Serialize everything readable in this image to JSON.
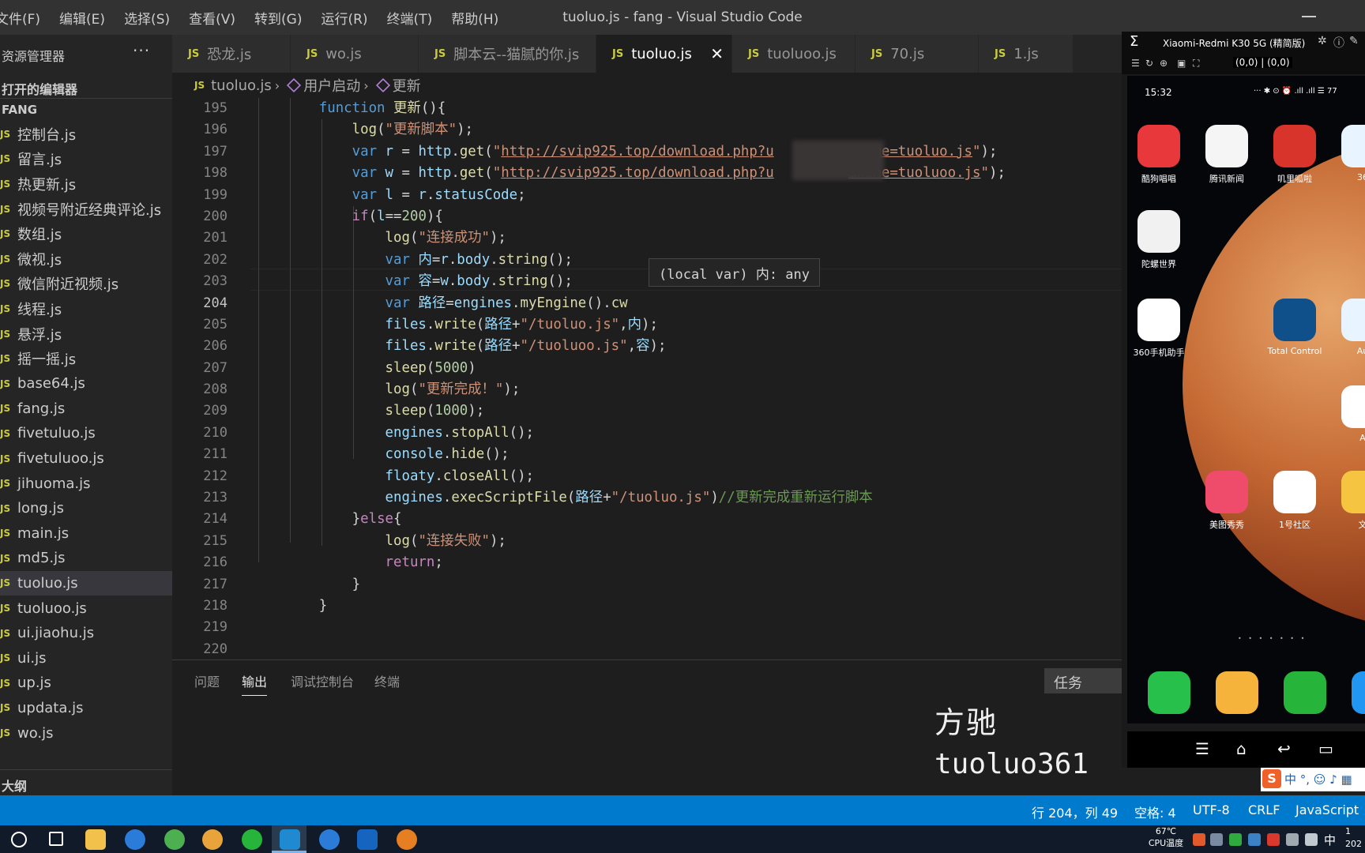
{
  "window": {
    "title": "tuoluo.js - fang - Visual Studio Code"
  },
  "menu": [
    "文件(F)",
    "编辑(E)",
    "选择(S)",
    "查看(V)",
    "转到(G)",
    "运行(R)",
    "终端(T)",
    "帮助(H)"
  ],
  "sidebar": {
    "title": "资源管理器",
    "more": "···",
    "open_editors": "打开的编辑器",
    "folder": "FANG",
    "files": [
      "控制台.js",
      "留言.js",
      "热更新.js",
      "视频号附近经典评论.js",
      "数组.js",
      "微视.js",
      "微信附近视频.js",
      "线程.js",
      "悬浮.js",
      "摇一摇.js",
      "base64.js",
      "fang.js",
      "fivetuluo.js",
      "fivetuluoo.js",
      "jihuoma.js",
      "long.js",
      "main.js",
      "md5.js",
      "tuoluo.js",
      "tuoluoo.js",
      "ui.jiaohu.js",
      "ui.js",
      "up.js",
      "updata.js",
      "wo.js"
    ],
    "active_file": "tuoluo.js",
    "outline": "大纲"
  },
  "tabs": [
    {
      "label": "恐龙.js",
      "active": false
    },
    {
      "label": "wo.js",
      "active": false
    },
    {
      "label": "脚本云--猫腻的你.js",
      "active": false
    },
    {
      "label": "tuoluo.js",
      "active": true
    },
    {
      "label": "tuoluoo.js",
      "active": false
    },
    {
      "label": "70.js",
      "active": false
    },
    {
      "label": "1.js",
      "active": false
    }
  ],
  "tab_badge": "JS",
  "breadcrumb": {
    "file": "tuoluo.js",
    "item1": "用户启动",
    "item2": "更新"
  },
  "editor": {
    "line_numbers": [
      "195",
      "196",
      "197",
      "198",
      "199",
      "200",
      "201",
      "202",
      "203",
      "204",
      "205",
      "206",
      "207",
      "208",
      "209",
      "210",
      "211",
      "212",
      "213",
      "214",
      "215",
      "216",
      "217",
      "218",
      "219",
      "220"
    ],
    "current_line": "204",
    "hover": "(local var) 内: any",
    "url1_prefix": "http://svip925.top/download.php?u",
    "url1_suffix": "&name=tuoluo.js",
    "url2_suffix": "&name=tuoluoo.js"
  },
  "panel": {
    "tabs": [
      "问题",
      "输出",
      "调试控制台",
      "终端"
    ],
    "active_tab": "输出",
    "task_select": "任务"
  },
  "watermark": {
    "name": "方驰",
    "handle": "tuoluo361"
  },
  "statusbar": {
    "position": "行 204，列 49",
    "spaces": "空格: 4",
    "encoding": "UTF-8",
    "eol": "CRLF",
    "language": "JavaScript"
  },
  "taskbar": {
    "cpu_temp": "67℃",
    "cpu_label": "CPU温度",
    "ime": "中",
    "clock_top": "1",
    "clock_bottom": "202"
  },
  "phone": {
    "device": "Xiaomi-Redmi K30 5G (精简版)",
    "coords": "(0,0) | (0,0)",
    "time": "15:32",
    "status_icons": "··· ✱ ⊙ ⏰ .ıll .ıll ☰ 77",
    "apps": [
      "酷狗唱唱",
      "腾讯新闻",
      "叽里呱啦",
      "36",
      "陀螺世界",
      "360手机助手",
      "Total Control",
      "Au",
      "A",
      "美图秀秀",
      "1号社区",
      "文"
    ],
    "page_dots": "• • • • • • •"
  },
  "ime_bar": {
    "logo": "S",
    "text": "中 °, ☺ ♪ ▦"
  },
  "colors": {
    "statusbar": "#007acc",
    "keyword": "#569cd6",
    "string": "#ce9178",
    "function": "#dcdcaa",
    "variable": "#9cdcfe",
    "comment": "#6a9955"
  }
}
